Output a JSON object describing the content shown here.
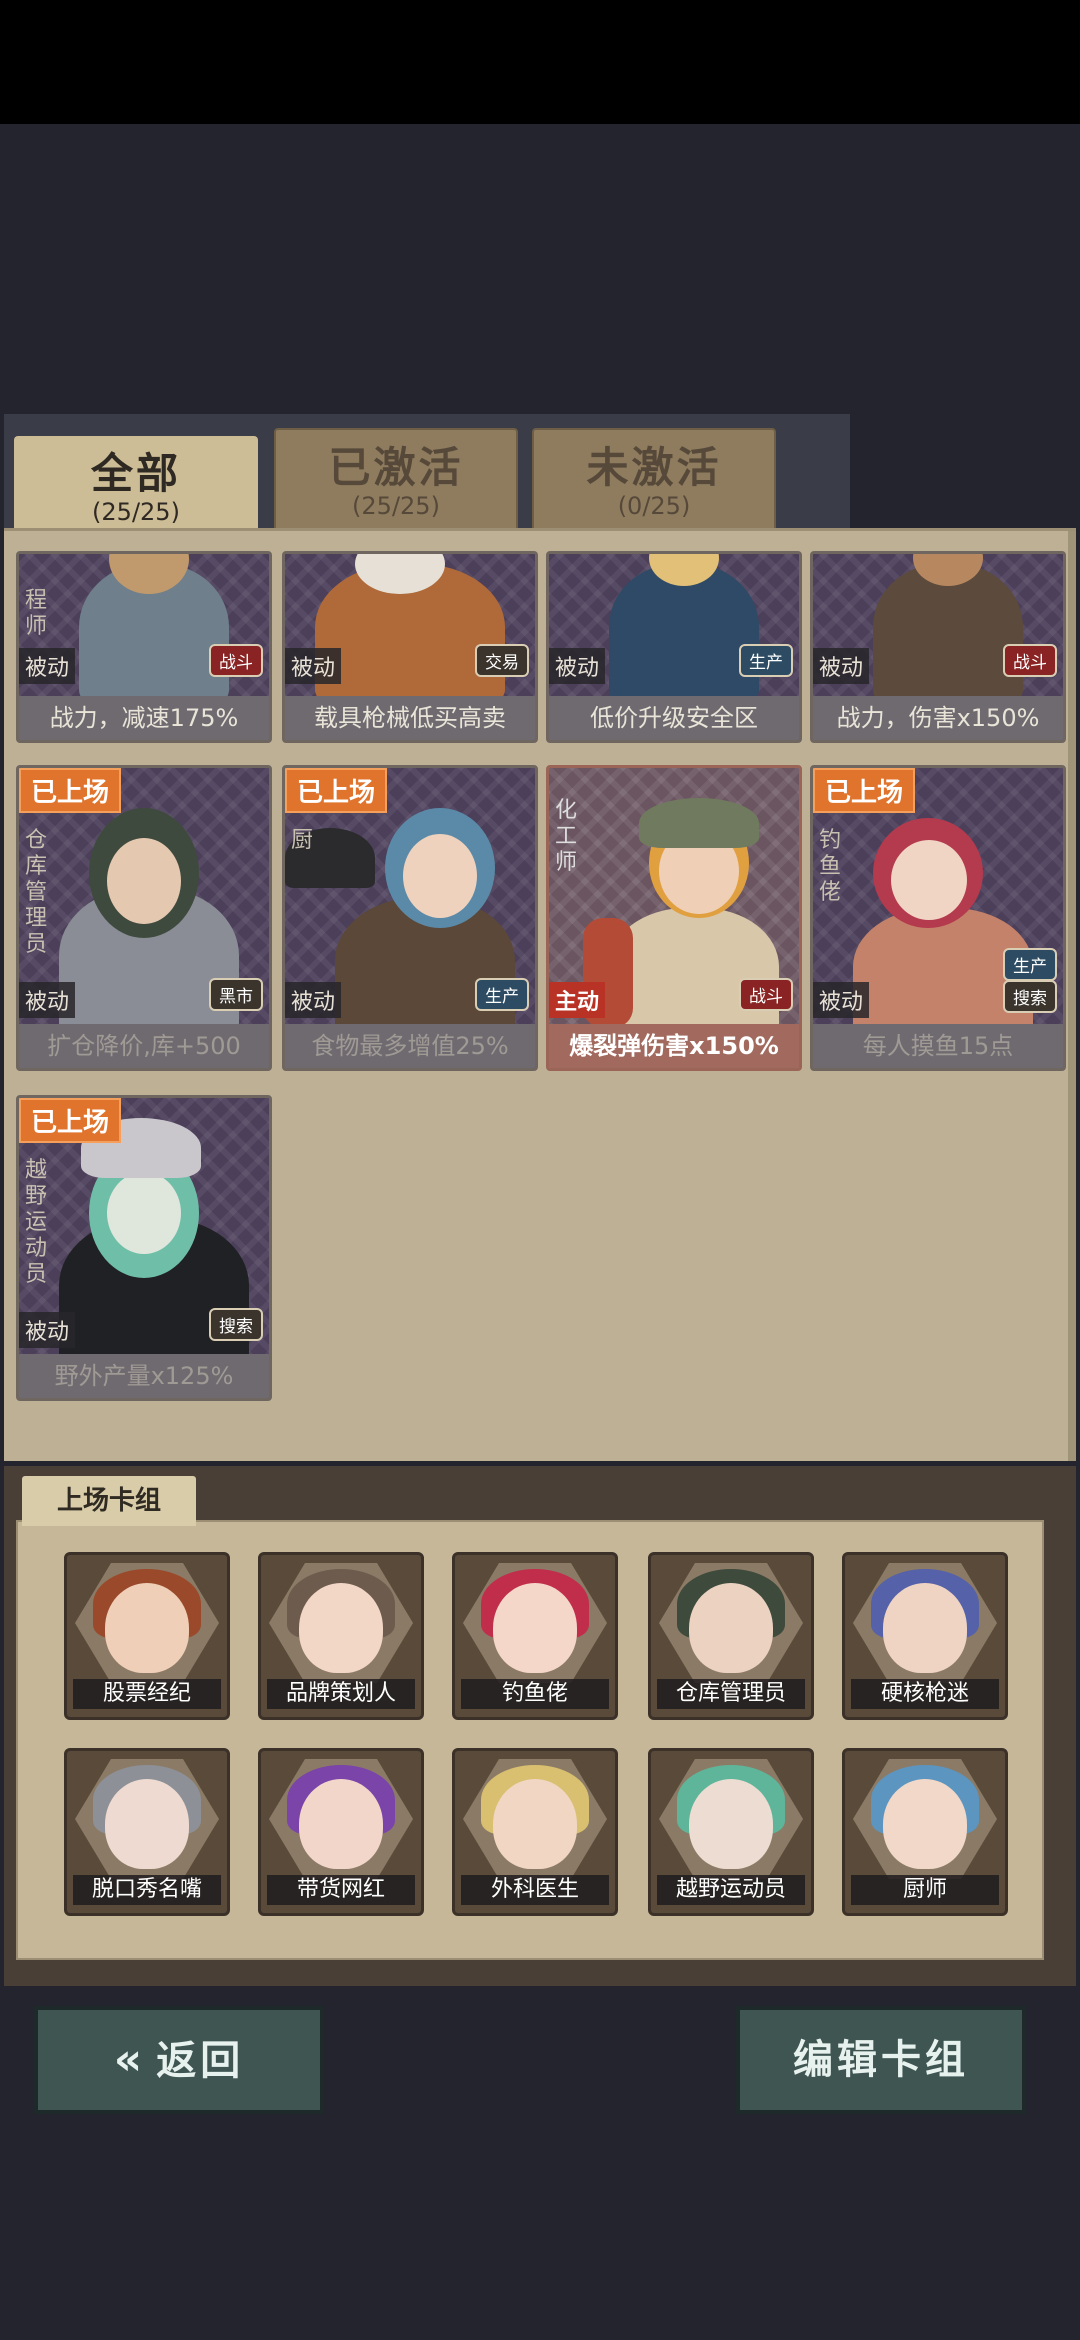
{
  "tabs": [
    {
      "label": "全部",
      "count": "(25/25)",
      "active": true
    },
    {
      "label": "已激活",
      "count": "(25/25)",
      "active": false
    },
    {
      "label": "未激活",
      "count": "(0/25)",
      "active": false
    }
  ],
  "cards": [
    {
      "role": "程师",
      "mode": "被动",
      "tag": "战斗",
      "tag_color": "red",
      "desc": "战力，减速175%",
      "on_stage": false
    },
    {
      "role": "",
      "mode": "被动",
      "tag": "交易",
      "tag_color": "dark",
      "desc": "载具枪械低买高卖",
      "on_stage": false
    },
    {
      "role": "",
      "mode": "被动",
      "tag": "生产",
      "tag_color": "blue",
      "desc": "低价升级安全区",
      "on_stage": false
    },
    {
      "role": "",
      "mode": "被动",
      "tag": "战斗",
      "tag_color": "red",
      "desc": "战力，伤害x150%",
      "on_stage": false
    },
    {
      "role": "仓库管理员",
      "mode": "被动",
      "tag": "黑市",
      "tag_color": "dark",
      "desc": "扩仓降价,库+500",
      "on_stage": true,
      "on_stage_label": "已上场"
    },
    {
      "role": "厨",
      "mode": "被动",
      "tag": "生产",
      "tag_color": "blue",
      "desc": "食物最多增值25%",
      "on_stage": true,
      "on_stage_label": "已上场"
    },
    {
      "role": "化工师",
      "mode": "主动",
      "tag": "战斗",
      "tag_color": "red",
      "desc": "爆裂弹伤害x150%",
      "on_stage": false
    },
    {
      "role": "钓鱼佬",
      "mode": "被动",
      "tag": "生产",
      "tag2": "搜索",
      "tag_color": "blue",
      "desc": "每人摸鱼15点",
      "on_stage": true,
      "on_stage_label": "已上场"
    },
    {
      "role": "越野运动员",
      "mode": "被动",
      "tag": "搜索",
      "tag_color": "dark",
      "desc": "野外产量x125%",
      "on_stage": true,
      "on_stage_label": "已上场"
    }
  ],
  "deck": {
    "label": "上场卡组",
    "members": [
      "股票经纪",
      "品牌策划人",
      "钓鱼佬",
      "仓库管理员",
      "硬核枪迷",
      "脱口秀名嘴",
      "带货网红",
      "外科医生",
      "越野运动员",
      "厨师"
    ]
  },
  "buttons": {
    "back": "返回",
    "edit": "编辑卡组"
  }
}
